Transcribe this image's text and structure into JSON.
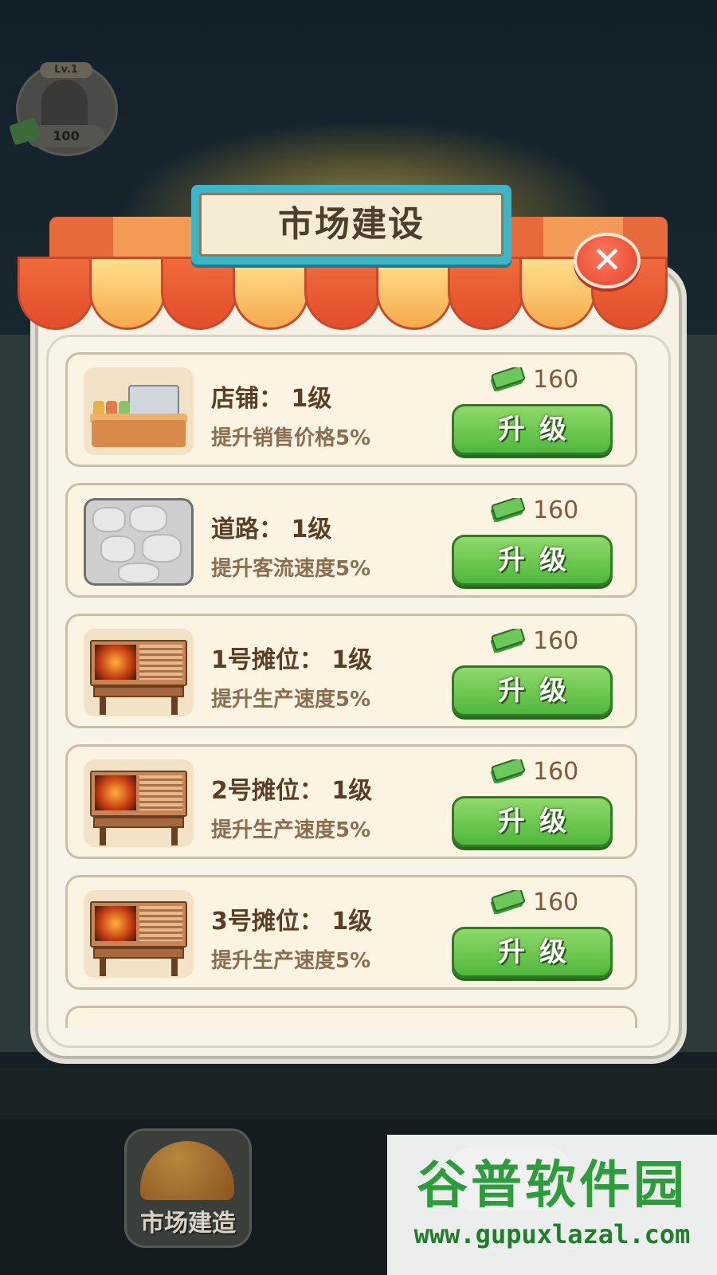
{
  "player": {
    "level": "Lv.1",
    "money": "100"
  },
  "modal": {
    "title": "市场建设",
    "close_icon": "close-icon"
  },
  "items": [
    {
      "name": "店铺： 1级",
      "desc": "提升销售价格5%",
      "price": "160",
      "button": "升级",
      "thumb": "shop-counter"
    },
    {
      "name": "道路： 1级",
      "desc": "提升客流速度5%",
      "price": "160",
      "button": "升级",
      "thumb": "stone-road"
    },
    {
      "name": "1号摊位： 1级",
      "desc": "提升生产速度5%",
      "price": "160",
      "button": "升级",
      "thumb": "grill-stall"
    },
    {
      "name": "2号摊位： 1级",
      "desc": "提升生产速度5%",
      "price": "160",
      "button": "升级",
      "thumb": "grill-stall"
    },
    {
      "name": "3号摊位： 1级",
      "desc": "提升生产速度5%",
      "price": "160",
      "button": "升级",
      "thumb": "grill-stall"
    }
  ],
  "bottom_nav": {
    "build_label": "市场建造"
  },
  "watermark": {
    "title": "谷普软件园",
    "url": "www.gupuxlazal.com"
  },
  "colors": {
    "awning_red": "#e66a3c",
    "awning_orange": "#f6a94c",
    "sign_teal": "#3ab6c8",
    "button_green": "#4fb83c",
    "close_red": "#e2412a",
    "card_bg": "#fbf4e2"
  }
}
